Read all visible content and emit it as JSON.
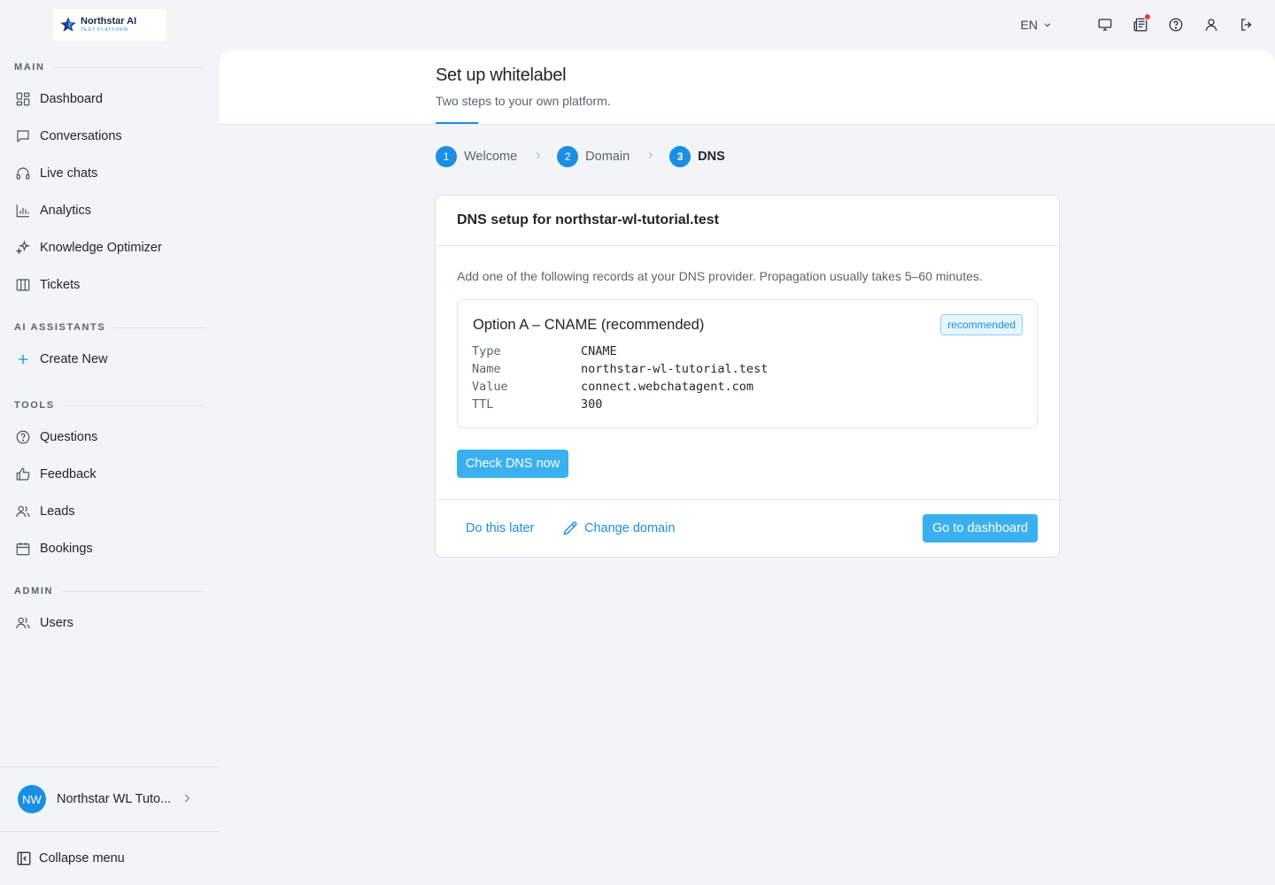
{
  "brand": {
    "name": "Northstar AI",
    "tagline": "TEST PLATFORM"
  },
  "topbar": {
    "language": "EN",
    "has_notification": true
  },
  "sidebar": {
    "sections": {
      "main": "MAIN",
      "ai_assistants": "AI ASSISTANTS",
      "tools": "TOOLS",
      "admin": "ADMIN"
    },
    "main_items": [
      {
        "label": "Dashboard",
        "icon": "grid-icon"
      },
      {
        "label": "Conversations",
        "icon": "chat-bubble-icon"
      },
      {
        "label": "Live chats",
        "icon": "headset-icon"
      },
      {
        "label": "Analytics",
        "icon": "bar-chart-icon"
      },
      {
        "label": "Knowledge Optimizer",
        "icon": "sparkles-icon"
      },
      {
        "label": "Tickets",
        "icon": "columns-icon"
      }
    ],
    "ai_items": [
      {
        "label": "Create New",
        "icon": "plus-icon"
      }
    ],
    "tools_items": [
      {
        "label": "Questions",
        "icon": "question-circle-icon"
      },
      {
        "label": "Feedback",
        "icon": "thumbs-up-icon"
      },
      {
        "label": "Leads",
        "icon": "users-icon"
      },
      {
        "label": "Bookings",
        "icon": "calendar-icon"
      }
    ],
    "admin_items": [
      {
        "label": "Users",
        "icon": "users-icon"
      }
    ],
    "account": {
      "initials": "NW",
      "name": "Northstar WL Tuto..."
    },
    "collapse_label": "Collapse menu"
  },
  "page": {
    "title": "Set up whitelabel",
    "subtitle": "Two steps to your own platform."
  },
  "steps": [
    {
      "num": "1",
      "label": "Welcome",
      "active": false
    },
    {
      "num": "2",
      "label": "Domain",
      "active": false
    },
    {
      "num": "3",
      "label": "DNS",
      "active": true
    }
  ],
  "dns_card": {
    "title": "DNS setup for northstar-wl-tutorial.test",
    "description": "Add one of the following records at your DNS provider. Propagation usually takes 5–60 minutes.",
    "option": {
      "title": "Option A – CNAME (recommended)",
      "badge": "recommended",
      "records": [
        {
          "key": "Type",
          "value": "CNAME"
        },
        {
          "key": "Name",
          "value": "northstar-wl-tutorial.test"
        },
        {
          "key": "Value",
          "value": "connect.webchatagent.com"
        },
        {
          "key": "TTL",
          "value": "300"
        }
      ]
    },
    "check_button": "Check DNS now",
    "later_link": "Do this later",
    "change_domain_link": "Change domain",
    "dashboard_button": "Go to dashboard"
  },
  "colors": {
    "accent": "#1a8fe3",
    "button": "#3ab0f0",
    "notification": "#e53935",
    "background": "#f2f4f6"
  }
}
